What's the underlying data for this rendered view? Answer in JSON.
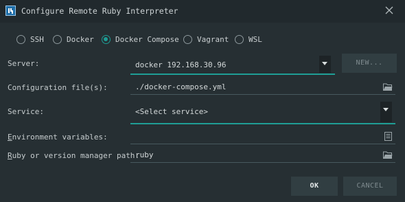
{
  "window": {
    "title": "Configure Remote Ruby Interpreter"
  },
  "radio_options": [
    {
      "label": "SSH",
      "checked": false
    },
    {
      "label": "Docker",
      "checked": false
    },
    {
      "label": "Docker Compose",
      "checked": true
    },
    {
      "label": "Vagrant",
      "checked": false
    },
    {
      "label": "WSL",
      "checked": false
    }
  ],
  "form": {
    "server_label": "Server:",
    "server_value": "docker 192.168.30.96",
    "new_button": "NEW...",
    "config_label": "Configuration file(s):",
    "config_value": "./docker-compose.yml",
    "service_label": "Service:",
    "service_value": "<Select service>",
    "env_label_first": "E",
    "env_label_rest": "nvironment variables:",
    "env_value": "",
    "ruby_label_first": "R",
    "ruby_label_rest": "uby or version manager path:",
    "ruby_value": "ruby"
  },
  "footer": {
    "ok_label": "OK",
    "cancel_label": "CANCEL"
  },
  "colors": {
    "background": "#262f33",
    "titlebar": "#21292d",
    "accent": "#1f9e95",
    "button": "#313e42"
  },
  "icons": {
    "app": "intellij-app-icon",
    "close": "close-icon",
    "browse": "folder-icon",
    "env": "document-icon",
    "dropdown": "chevron-down-icon"
  }
}
